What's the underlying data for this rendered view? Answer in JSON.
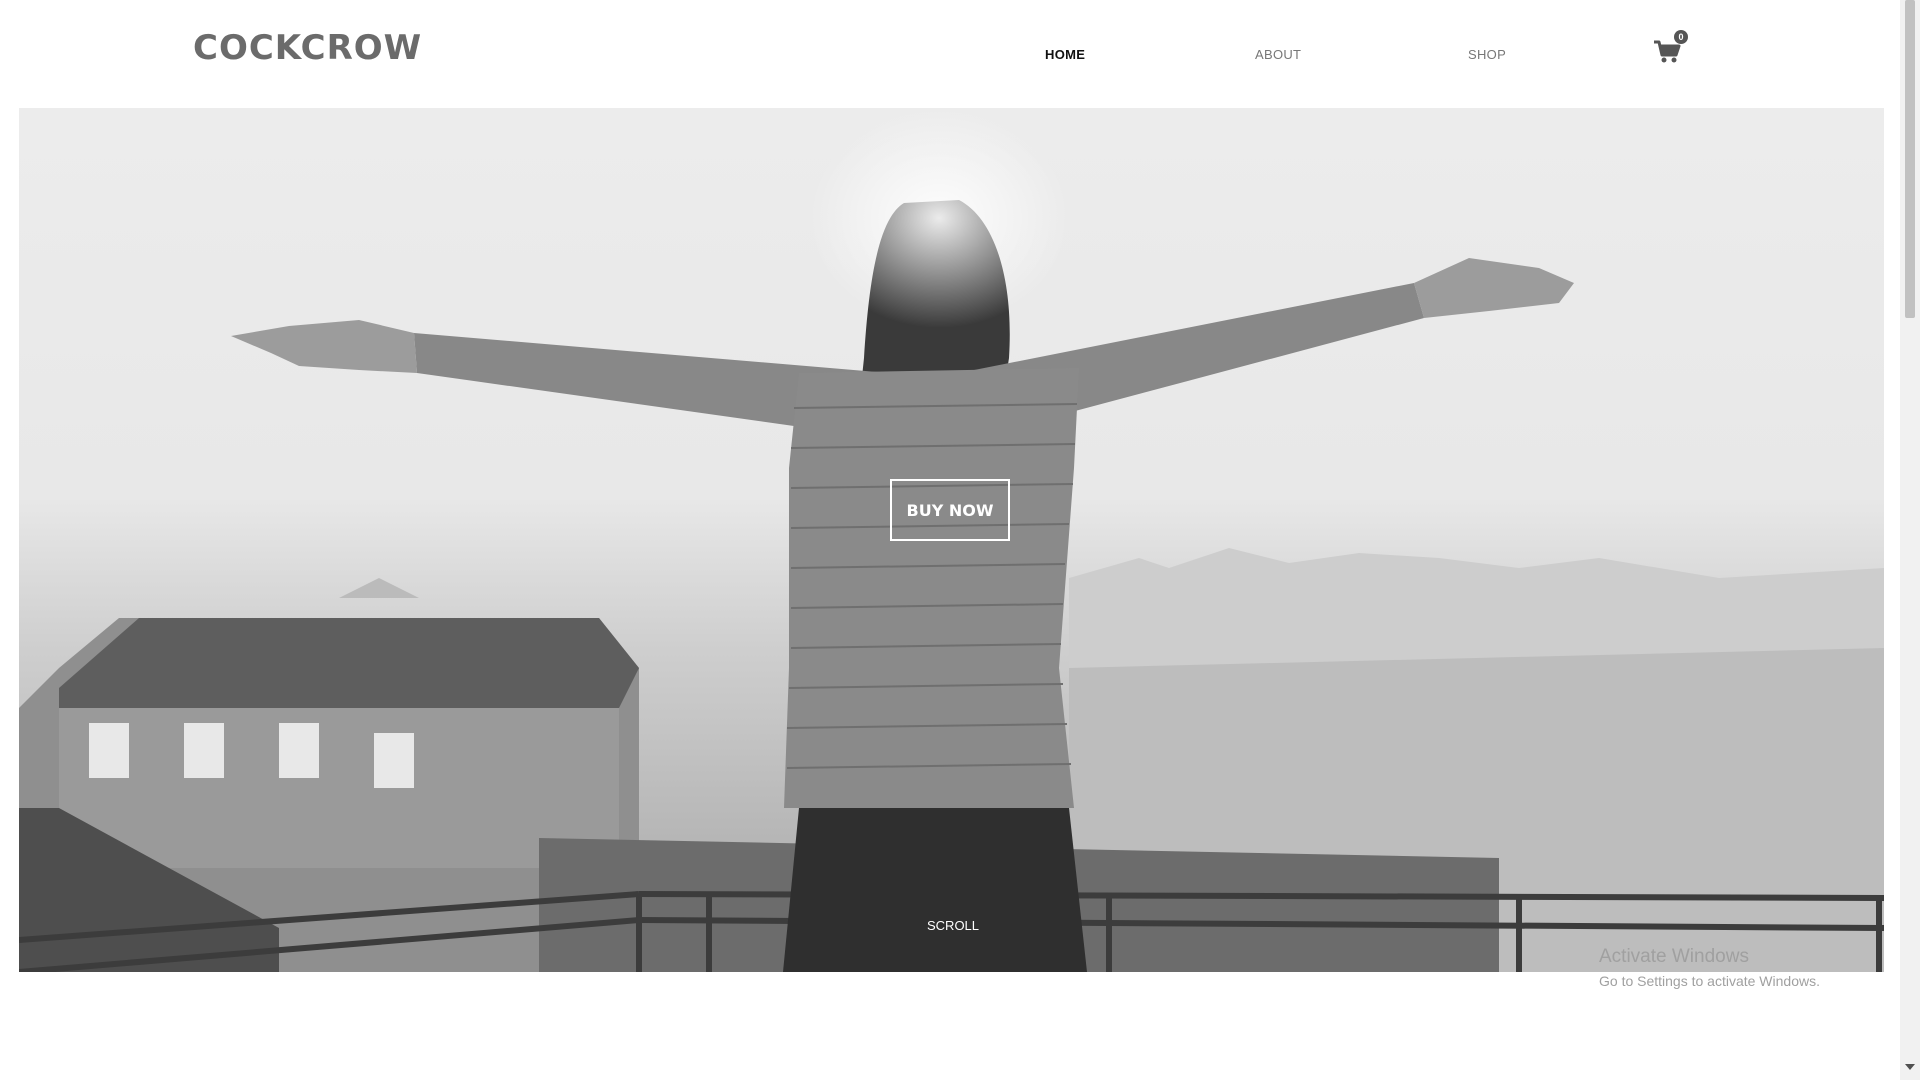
{
  "header": {
    "logo": "COCKCROW",
    "nav": [
      {
        "label": "HOME",
        "active": true
      },
      {
        "label": "ABOUT",
        "active": false
      },
      {
        "label": "SHOP",
        "active": false
      }
    ],
    "cart": {
      "count": "0",
      "icon": "shopping-cart-icon"
    }
  },
  "hero": {
    "image": "woman-arms-outstretched-balcony-city",
    "cta_label": "BUY NOW",
    "scroll_label": "SCROLL"
  },
  "os_overlay": {
    "title": "Activate Windows",
    "subtitle": "Go to Settings to activate Windows."
  }
}
